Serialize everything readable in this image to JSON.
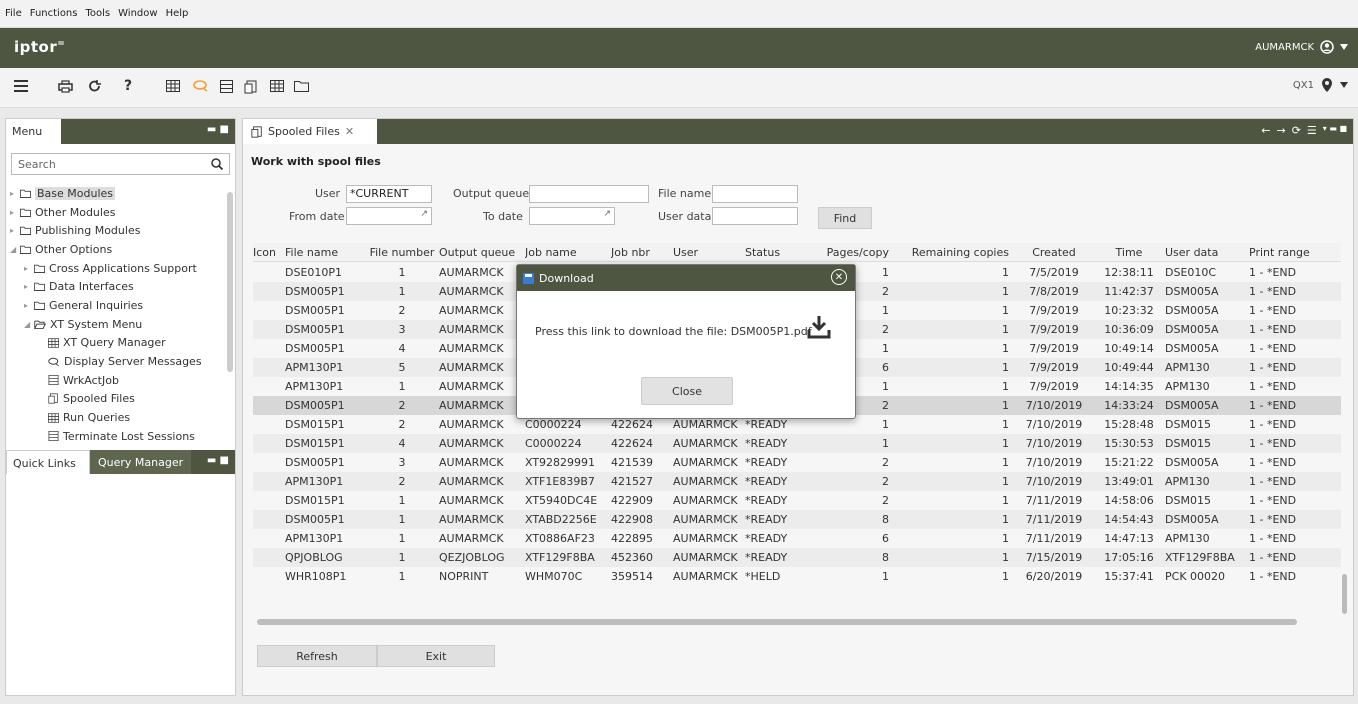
{
  "menubar": [
    "File",
    "Functions",
    "Tools",
    "Window",
    "Help"
  ],
  "brand": {
    "logo": "iptor",
    "user": "AUMARMCK",
    "accent": "#4e5540"
  },
  "toolbar": {
    "system": "QX1"
  },
  "left": {
    "tab": "Menu",
    "search_placeholder": "Search",
    "tree": [
      {
        "label": "Base Modules",
        "indent": 0,
        "icon": "folder-icon",
        "selected": true
      },
      {
        "label": "Other Modules",
        "indent": 0,
        "icon": "folder-icon"
      },
      {
        "label": "Publishing Modules",
        "indent": 0,
        "icon": "folder-icon"
      },
      {
        "label": "Other Options",
        "indent": 0,
        "icon": "folder-icon",
        "open": true
      },
      {
        "label": "Cross Applications Support",
        "indent": 1,
        "icon": "folder-icon"
      },
      {
        "label": "Data Interfaces",
        "indent": 1,
        "icon": "folder-icon"
      },
      {
        "label": "General Inquiries",
        "indent": 1,
        "icon": "folder-icon"
      },
      {
        "label": "XT System Menu",
        "indent": 1,
        "icon": "folder-open-icon",
        "open": true
      },
      {
        "label": "XT Query Manager",
        "indent": 2,
        "icon": "grid-icon"
      },
      {
        "label": "Display Server Messages",
        "indent": 2,
        "icon": "chat-icon"
      },
      {
        "label": "WrkActJob",
        "indent": 2,
        "icon": "server-icon"
      },
      {
        "label": "Spooled Files",
        "indent": 2,
        "icon": "spool-icon"
      },
      {
        "label": "Run Queries",
        "indent": 2,
        "icon": "grid-icon"
      },
      {
        "label": "Terminate Lost Sessions",
        "indent": 2,
        "icon": "server-icon"
      }
    ],
    "quick_links": "Quick Links",
    "query_manager": "Query Manager"
  },
  "main": {
    "tab": "Spooled Files",
    "title": "Work with spool files",
    "form": {
      "user_label": "User",
      "user_value": "*CURRENT",
      "outq_label": "Output queue",
      "outq_value": "",
      "fname_label": "File name",
      "fname_value": "",
      "from_label": "From date",
      "from_value": "",
      "to_label": "To date",
      "to_value": "",
      "udata_label": "User data",
      "udata_value": "",
      "find": "Find"
    },
    "columns": [
      "Icon",
      "File name",
      "File number",
      "Output queue",
      "Job name",
      "Job nbr",
      "User",
      "Status",
      "Pages/copy",
      "Remaining copies",
      "Created",
      "Time",
      "User data",
      "Print range"
    ],
    "rows": [
      [
        "",
        "DSE010P1",
        "1",
        "AUMARMCK",
        "",
        "",
        "",
        "",
        "1",
        "1",
        "7/5/2019",
        "12:38:11",
        "DSE010C",
        "1 - *END"
      ],
      [
        "",
        "DSM005P1",
        "1",
        "AUMARMCK",
        "",
        "",
        "",
        "",
        "2",
        "1",
        "7/8/2019",
        "11:42:37",
        "DSM005A",
        "1 - *END"
      ],
      [
        "",
        "DSM005P1",
        "2",
        "AUMARMCK",
        "",
        "",
        "",
        "",
        "1",
        "1",
        "7/9/2019",
        "10:23:32",
        "DSM005A",
        "1 - *END"
      ],
      [
        "",
        "DSM005P1",
        "3",
        "AUMARMCK",
        "",
        "",
        "",
        "",
        "2",
        "1",
        "7/9/2019",
        "10:36:09",
        "DSM005A",
        "1 - *END"
      ],
      [
        "",
        "DSM005P1",
        "4",
        "AUMARMCK",
        "",
        "",
        "",
        "",
        "1",
        "1",
        "7/9/2019",
        "10:49:14",
        "DSM005A",
        "1 - *END"
      ],
      [
        "",
        "APM130P1",
        "5",
        "AUMARMCK",
        "",
        "",
        "",
        "",
        "6",
        "1",
        "7/9/2019",
        "10:49:44",
        "APM130",
        "1 - *END"
      ],
      [
        "",
        "APM130P1",
        "1",
        "AUMARMCK",
        "",
        "",
        "",
        "",
        "1",
        "1",
        "7/9/2019",
        "14:14:35",
        "APM130",
        "1 - *END"
      ],
      [
        "",
        "DSM005P1",
        "2",
        "AUMARMCK",
        "",
        "",
        "",
        "",
        "2",
        "1",
        "7/10/2019",
        "14:33:24",
        "DSM005A",
        "1 - *END"
      ],
      [
        "",
        "DSM015P1",
        "2",
        "AUMARMCK",
        "C0000224",
        "422624",
        "AUMARMCK",
        "*READY",
        "1",
        "1",
        "7/10/2019",
        "15:28:48",
        "DSM015",
        "1 - *END"
      ],
      [
        "",
        "DSM015P1",
        "4",
        "AUMARMCK",
        "C0000224",
        "422624",
        "AUMARMCK",
        "*READY",
        "1",
        "1",
        "7/10/2019",
        "15:30:53",
        "DSM015",
        "1 - *END"
      ],
      [
        "",
        "DSM005P1",
        "3",
        "AUMARMCK",
        "XT92829991",
        "421539",
        "AUMARMCK",
        "*READY",
        "2",
        "1",
        "7/10/2019",
        "15:21:22",
        "DSM005A",
        "1 - *END"
      ],
      [
        "",
        "APM130P1",
        "2",
        "AUMARMCK",
        "XTF1E839B7",
        "421527",
        "AUMARMCK",
        "*READY",
        "2",
        "1",
        "7/10/2019",
        "13:49:01",
        "APM130",
        "1 - *END"
      ],
      [
        "",
        "DSM015P1",
        "1",
        "AUMARMCK",
        "XT5940DC4E",
        "422909",
        "AUMARMCK",
        "*READY",
        "2",
        "1",
        "7/11/2019",
        "14:58:06",
        "DSM015",
        "1 - *END"
      ],
      [
        "",
        "DSM005P1",
        "1",
        "AUMARMCK",
        "XTABD2256E",
        "422908",
        "AUMARMCK",
        "*READY",
        "8",
        "1",
        "7/11/2019",
        "14:54:43",
        "DSM005A",
        "1 - *END"
      ],
      [
        "",
        "APM130P1",
        "1",
        "AUMARMCK",
        "XT0886AF23",
        "422895",
        "AUMARMCK",
        "*READY",
        "6",
        "1",
        "7/11/2019",
        "14:47:13",
        "APM130",
        "1 - *END"
      ],
      [
        "",
        "QPJOBLOG",
        "1",
        "QEZJOBLOG",
        "XTF129F8BA",
        "452360",
        "AUMARMCK",
        "*READY",
        "8",
        "1",
        "7/15/2019",
        "17:05:16",
        "XTF129F8BA",
        "1 - *END"
      ],
      [
        "",
        "WHR108P1",
        "1",
        "NOPRINT",
        "WHM070C",
        "359514",
        "AUMARMCK",
        "*HELD",
        "1",
        "1",
        "6/20/2019",
        "15:37:41",
        "PCK 00020",
        "1 - *END"
      ]
    ],
    "selected_row": 7,
    "refresh": "Refresh",
    "exit": "Exit"
  },
  "modal": {
    "title": "Download",
    "message": "Press this link to download the file: DSM005P1.pdf",
    "close": "Close"
  }
}
